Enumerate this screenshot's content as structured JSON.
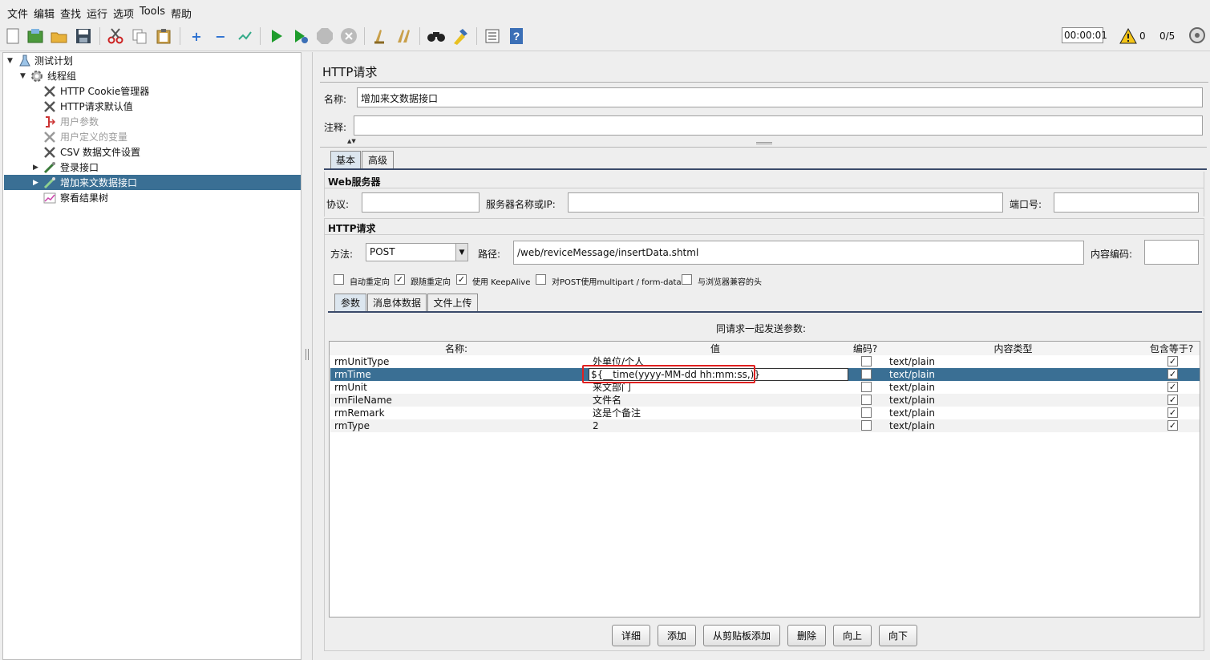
{
  "menu": [
    "文件",
    "编辑",
    "查找",
    "运行",
    "选项",
    "Tools",
    "帮助"
  ],
  "toolbar": {
    "icons": [
      "new-icon",
      "templates-icon",
      "open-icon",
      "save-icon",
      "cut-icon",
      "copy-icon",
      "paste-icon",
      "expand-icon",
      "collapse-icon",
      "toggle-icon",
      "start-icon",
      "start-no-pause-icon",
      "stop-icon",
      "shutdown-icon",
      "clear-icon",
      "clear-all-icon",
      "search-icon",
      "reset-search-icon",
      "function-helper-icon",
      "help-icon"
    ],
    "timer": "00:00:01",
    "warning_count": "0",
    "threads": "0/5"
  },
  "tree": {
    "items": [
      {
        "label": "测试计划",
        "icon": "test-plan-icon",
        "disabled": false
      },
      {
        "label": "线程组",
        "icon": "gear-icon",
        "disabled": false
      },
      {
        "label": "HTTP Cookie管理器",
        "icon": "wrench-icon",
        "disabled": false
      },
      {
        "label": "HTTP请求默认值",
        "icon": "wrench-icon",
        "disabled": false
      },
      {
        "label": "用户参数",
        "icon": "preprocessor-icon",
        "disabled": true
      },
      {
        "label": "用户定义的变量",
        "icon": "wrench-icon",
        "disabled": true
      },
      {
        "label": "CSV 数据文件设置",
        "icon": "wrench-icon",
        "disabled": false
      },
      {
        "label": "登录接口",
        "icon": "sampler-icon",
        "disabled": false
      },
      {
        "label": "增加来文数据接口",
        "icon": "sampler-icon",
        "disabled": false
      },
      {
        "label": "察看结果树",
        "icon": "listener-icon",
        "disabled": false
      }
    ]
  },
  "panel": {
    "title": "HTTP请求",
    "name_label": "名称:",
    "name_value": "增加来文数据接口",
    "comment_label": "注释:",
    "comment_value": "",
    "tabs": [
      "基本",
      "高级"
    ],
    "web_server_title": "Web服务器",
    "protocol_label": "协议:",
    "server_label": "服务器名称或IP:",
    "port_label": "端口号:",
    "http_title": "HTTP请求",
    "method_label": "方法:",
    "method_value": "POST",
    "path_label": "路径:",
    "path_value": "/web/reviceMessage/insertData.shtml",
    "encoding_label": "内容编码:",
    "options": [
      {
        "label": "自动重定向",
        "checked": false
      },
      {
        "label": "跟随重定向",
        "checked": true
      },
      {
        "label": "使用 KeepAlive",
        "checked": true
      },
      {
        "label": "对POST使用multipart / form-data",
        "checked": false
      },
      {
        "label": "与浏览器兼容的头",
        "checked": false
      }
    ],
    "sub_tabs": [
      "参数",
      "消息体数据",
      "文件上传"
    ],
    "params_title": "同请求一起发送参数:",
    "columns": [
      "名称:",
      "值",
      "编码?",
      "内容类型",
      "包含等于?"
    ],
    "rows": [
      {
        "name": "rmUnitType",
        "value": "外单位/个人",
        "encode": false,
        "type": "text/plain",
        "include": true
      },
      {
        "name": "rmTime",
        "value": "${__time(yyyy-MM-dd hh:mm:ss,)}",
        "encode": false,
        "type": "text/plain",
        "include": true
      },
      {
        "name": "rmUnit",
        "value": "来文部门",
        "encode": false,
        "type": "text/plain",
        "include": true
      },
      {
        "name": "rmFileName",
        "value": "文件名",
        "encode": false,
        "type": "text/plain",
        "include": true
      },
      {
        "name": "rmRemark",
        "value": "这是个备注",
        "encode": false,
        "type": "text/plain",
        "include": true
      },
      {
        "name": "rmType",
        "value": "2",
        "encode": false,
        "type": "text/plain",
        "include": true
      }
    ],
    "buttons": [
      "详细",
      "添加",
      "从剪贴板添加",
      "删除",
      "向上",
      "向下"
    ]
  },
  "colors": {
    "selection": "#3a6f94",
    "highlight_box": "#e02020"
  }
}
